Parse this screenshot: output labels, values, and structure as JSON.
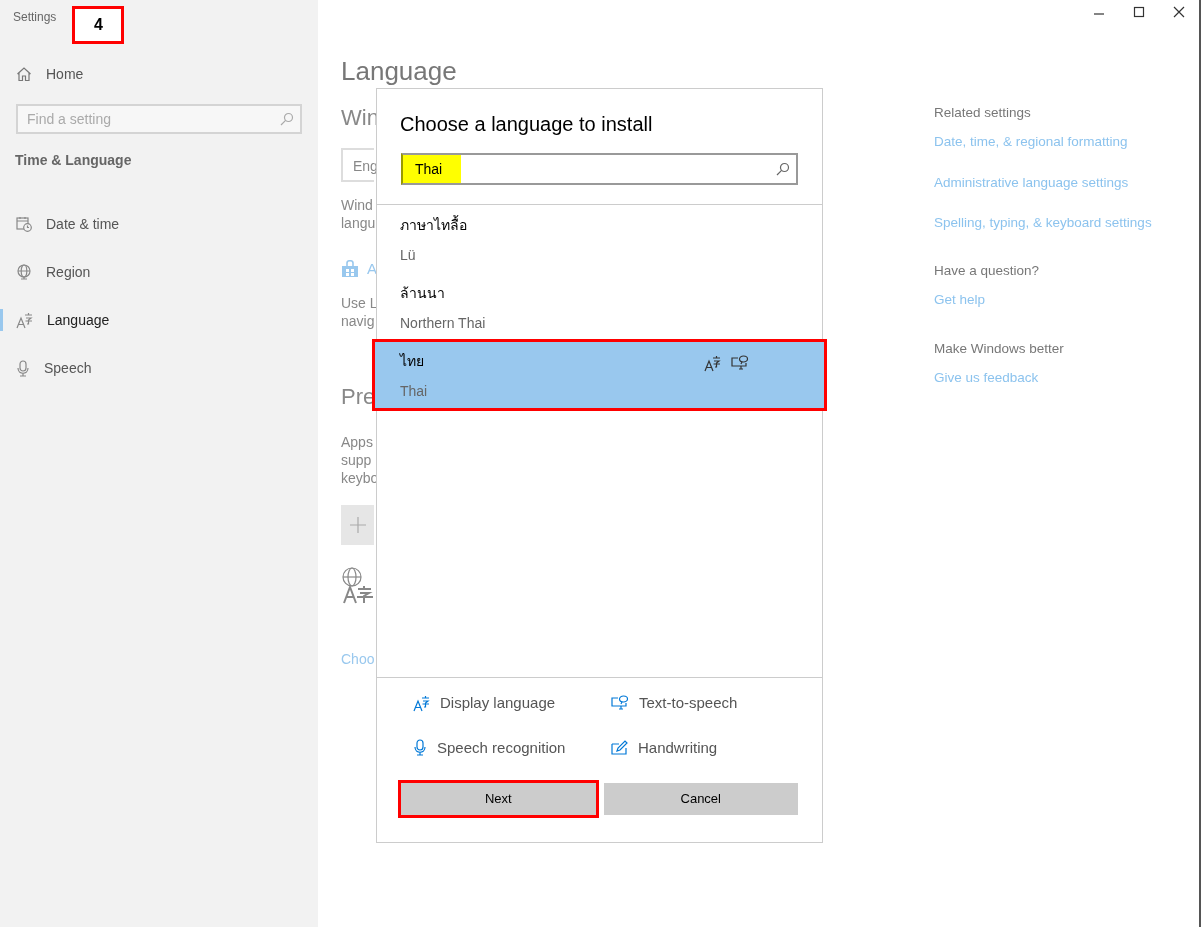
{
  "window": {
    "title": "Settings"
  },
  "annotation": {
    "step": "4"
  },
  "sidebar": {
    "home": "Home",
    "search": {
      "placeholder": "Find a setting"
    },
    "section": "Time & Language",
    "items": [
      {
        "kind": "calendar",
        "label": "Date & time",
        "selected": false
      },
      {
        "kind": "region",
        "label": "Region",
        "selected": false
      },
      {
        "kind": "language",
        "label": "Language",
        "selected": true
      },
      {
        "kind": "speech",
        "label": "Speech",
        "selected": false
      }
    ]
  },
  "page": {
    "title": "Language",
    "fragments": [
      {
        "kind": "heading",
        "text": "Win"
      },
      {
        "kind": "field",
        "text": "Eng"
      },
      {
        "kind": "text",
        "lines": [
          "Wind",
          "langu"
        ]
      },
      {
        "kind": "store_link",
        "text": "A"
      },
      {
        "kind": "text",
        "lines": [
          "Use L",
          "navig"
        ]
      },
      {
        "kind": "heading",
        "text": "Pre"
      },
      {
        "kind": "text",
        "lines": [
          "Apps",
          "supp",
          "keybo"
        ]
      },
      {
        "kind": "add_button"
      },
      {
        "kind": "language_icon"
      },
      {
        "kind": "link",
        "text": "Choo"
      }
    ]
  },
  "dialog": {
    "title": "Choose a language to install",
    "search": {
      "value": "Thai",
      "highlighted": true
    },
    "languages": [
      {
        "native": "ภาษาไทลื้อ",
        "name": "Lü",
        "selected": false,
        "highlighted": false
      },
      {
        "native": "ล้านนา",
        "name": "Northern Thai",
        "selected": false,
        "highlighted": false
      },
      {
        "native": "ไทย",
        "name": "Thai",
        "selected": true,
        "highlighted": true,
        "features": [
          {
            "kind": "display_language"
          },
          {
            "kind": "text_to_speech"
          }
        ]
      }
    ],
    "features": [
      {
        "kind": "display_language",
        "label": "Display language"
      },
      {
        "kind": "text_to_speech",
        "label": "Text-to-speech"
      },
      {
        "kind": "speech_recognition",
        "label": "Speech recognition"
      },
      {
        "kind": "handwriting",
        "label": "Handwriting"
      }
    ],
    "buttons": [
      {
        "label": "Next",
        "highlighted": true
      },
      {
        "label": "Cancel",
        "highlighted": false
      }
    ]
  },
  "related": [
    {
      "heading": "Related settings",
      "links": [
        "Date, time, & regional formatting",
        "Administrative language settings",
        "Spelling, typing, & keyboard settings"
      ]
    },
    {
      "heading": "Have a question?",
      "links": [
        "Get help"
      ]
    },
    {
      "heading": "Make Windows better",
      "links": [
        "Give us feedback"
      ]
    }
  ]
}
